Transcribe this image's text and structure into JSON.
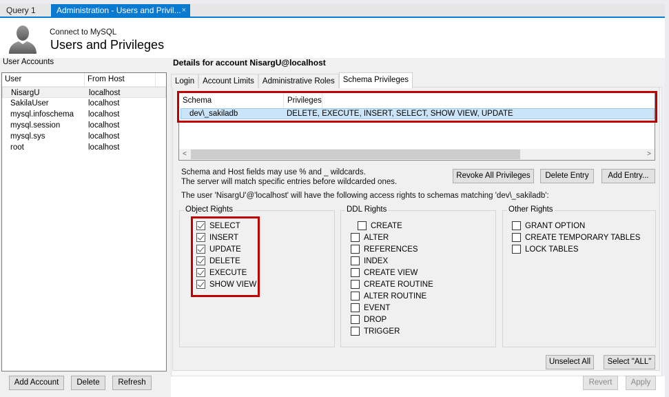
{
  "tabs": [
    {
      "label": "Query 1",
      "active": false
    },
    {
      "label": "Administration - Users and Privil...",
      "active": true,
      "close": "×"
    }
  ],
  "header": {
    "subtitle": "Connect to MySQL",
    "title": "Users and Privileges",
    "icon": "user-silhouette-icon"
  },
  "user_accounts": {
    "label": "User Accounts",
    "columns": [
      "User",
      "From Host"
    ],
    "rows": [
      {
        "user": "NisargU",
        "host": "localhost",
        "selected": true
      },
      {
        "user": "SakilaUser",
        "host": "localhost"
      },
      {
        "user": "mysql.infoschema",
        "host": "localhost"
      },
      {
        "user": "mysql.session",
        "host": "localhost"
      },
      {
        "user": "mysql.sys",
        "host": "localhost"
      },
      {
        "user": "root",
        "host": "localhost"
      }
    ],
    "buttons": {
      "add": "Add Account",
      "delete": "Delete",
      "refresh": "Refresh"
    }
  },
  "details": {
    "title": "Details for account NisargU@localhost",
    "tabs": [
      "Login",
      "Account Limits",
      "Administrative Roles",
      "Schema Privileges"
    ],
    "active_tab": "Schema Privileges",
    "schema_grid": {
      "columns": [
        "Schema",
        "Privileges"
      ],
      "rows": [
        {
          "schema": "dev\\_sakiladb",
          "privileges": "DELETE, EXECUTE, INSERT, SELECT, SHOW VIEW, UPDATE"
        }
      ],
      "scroll_left": "<",
      "scroll_right": ">"
    },
    "info_line1": "Schema and Host fields may use % and _ wildcards.",
    "info_line2": "The server will match specific entries before wildcarded ones.",
    "access_line": "The user 'NisargU'@'localhost' will have the following access rights to schemas matching 'dev\\_sakiladb':",
    "buttons": {
      "revoke_all": "Revoke All Privileges",
      "delete_entry": "Delete Entry",
      "add_entry": "Add Entry...",
      "unselect_all": "Unselect All",
      "select_all": "Select \"ALL\""
    },
    "object_rights": {
      "label": "Object Rights",
      "items": [
        {
          "label": "SELECT",
          "checked": true
        },
        {
          "label": "INSERT",
          "checked": true
        },
        {
          "label": "UPDATE",
          "checked": true
        },
        {
          "label": "DELETE",
          "checked": true
        },
        {
          "label": "EXECUTE",
          "checked": true
        },
        {
          "label": "SHOW VIEW",
          "checked": true
        }
      ]
    },
    "ddl_rights": {
      "label": "DDL Rights",
      "items": [
        {
          "label": "CREATE",
          "checked": false
        },
        {
          "label": "ALTER",
          "checked": false
        },
        {
          "label": "REFERENCES",
          "checked": false
        },
        {
          "label": "INDEX",
          "checked": false
        },
        {
          "label": "CREATE VIEW",
          "checked": false
        },
        {
          "label": "CREATE ROUTINE",
          "checked": false
        },
        {
          "label": "ALTER ROUTINE",
          "checked": false
        },
        {
          "label": "EVENT",
          "checked": false
        },
        {
          "label": "DROP",
          "checked": false
        },
        {
          "label": "TRIGGER",
          "checked": false
        }
      ]
    },
    "other_rights": {
      "label": "Other Rights",
      "items": [
        {
          "label": "GRANT OPTION",
          "checked": false
        },
        {
          "label": "CREATE TEMPORARY TABLES",
          "checked": false
        },
        {
          "label": "LOCK TABLES",
          "checked": false
        }
      ]
    }
  },
  "footer": {
    "revert": "Revert",
    "apply": "Apply"
  },
  "colors": {
    "accent": "#0a79d0",
    "highlight": "#c00000",
    "selection": "#cce4f7"
  }
}
